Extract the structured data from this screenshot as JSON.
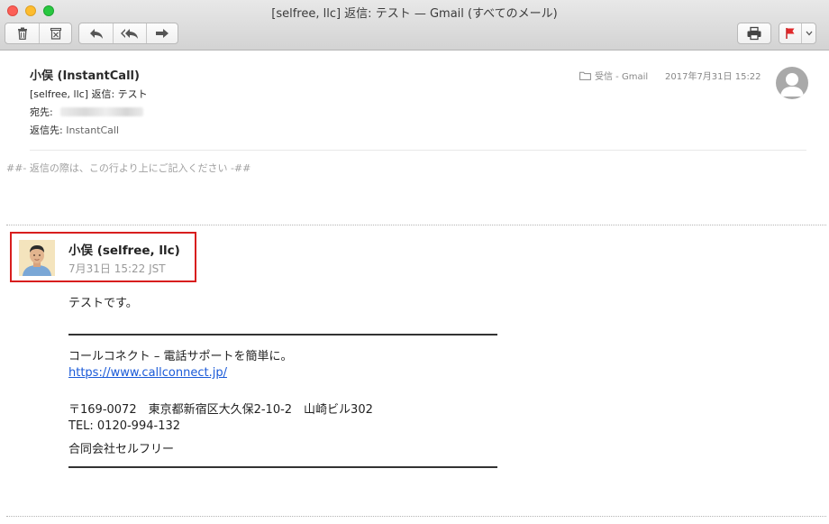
{
  "window": {
    "title": "[selfree, llc] 返信: テスト — Gmail (すべてのメール)"
  },
  "toolbar": {
    "buttons": [
      "trash-icon",
      "archive-icon",
      "reply-icon",
      "reply-all-icon",
      "forward-icon",
      "print-icon",
      "flag-icon"
    ],
    "flag_color": "#e0292b"
  },
  "header": {
    "from": "小俣 (InstantCall)",
    "subject": "[selfree, llc] 返信: テスト",
    "to_label": "宛先:",
    "reply_to_label": "返信先:",
    "reply_to_value": "InstantCall",
    "mailbox": "受信 - Gmail",
    "date": "2017年7月31日 15:22"
  },
  "quote_marker": "##- 返信の際は、この行より上にご記入ください -##",
  "message": {
    "author": "小俣 (selfree, llc)",
    "date": "7月31日 15:22 JST",
    "greeting": "テストです。",
    "signature": {
      "tagline": "コールコネクト – 電話サポートを簡単に。",
      "url": "https://www.callconnect.jp/",
      "address": "〒169-0072　東京都新宿区大久保2-10-2　山崎ビル302",
      "tel": "TEL: 0120-994-132",
      "company": "合同会社セルフリー"
    }
  },
  "colors": {
    "highlight_border": "#d81e1e",
    "link": "#1a5ad8"
  }
}
